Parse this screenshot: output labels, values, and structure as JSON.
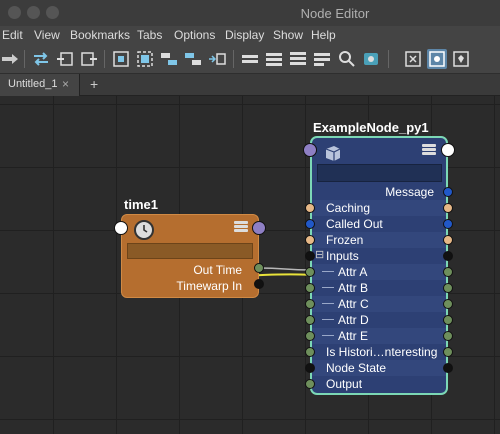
{
  "window": {
    "title": "Node Editor"
  },
  "menubar": [
    "Edit",
    "View",
    "Bookmarks",
    "Tabs",
    "Options",
    "Display",
    "Show",
    "Help"
  ],
  "toolbar": {
    "icons": [
      "graph-input-output-icon",
      "swap-connections-icon",
      "add-input-icon",
      "add-output-icon",
      "frame-all-icon",
      "frame-selected-icon",
      "graph-upstream-icon",
      "graph-downstream-icon",
      "layout-icon",
      "simple-mode-icon",
      "connected-mode-icon",
      "full-mode-icon",
      "custom-mode-icon",
      "search-icon",
      "snapshot-icon",
      "grid-toggle-icon",
      "grid-snap-icon",
      "pin-icon"
    ]
  },
  "tabs": [
    {
      "label": "Untitled_1",
      "close": "×"
    }
  ],
  "tab_add": "+",
  "time_node": {
    "name": "time1",
    "attributes": [
      "Out Time",
      "Timewarp In"
    ]
  },
  "example_node": {
    "name": "ExampleNode_py1",
    "attributes": [
      {
        "label": "Message",
        "align": "right",
        "alt": false,
        "in": null,
        "out": "#2158c8"
      },
      {
        "label": "Caching",
        "align": "left",
        "alt": true,
        "in": "#e6b887",
        "out": "#e6b887"
      },
      {
        "label": "Called Out",
        "align": "left",
        "alt": false,
        "in": "#2158c8",
        "out": "#2158c8"
      },
      {
        "label": "Frozen",
        "align": "left",
        "alt": true,
        "in": "#e6b887",
        "out": "#e6b887"
      },
      {
        "label": "Inputs",
        "align": "left",
        "alt": false,
        "in": "#111111",
        "out": "#111111",
        "group": true
      },
      {
        "label": "Attr A",
        "align": "child",
        "alt": true,
        "in": "#6e8f5c",
        "out": "#6e8f5c"
      },
      {
        "label": "Attr B",
        "align": "child",
        "alt": false,
        "in": "#6e8f5c",
        "out": "#6e8f5c"
      },
      {
        "label": "Attr C",
        "align": "child",
        "alt": true,
        "in": "#6e8f5c",
        "out": "#6e8f5c"
      },
      {
        "label": "Attr D",
        "align": "child",
        "alt": false,
        "in": "#6e8f5c",
        "out": "#6e8f5c"
      },
      {
        "label": "Attr E",
        "align": "child",
        "alt": true,
        "in": "#6e8f5c",
        "out": "#6e8f5c"
      },
      {
        "label": "Is Histori…nteresting",
        "align": "left",
        "alt": false,
        "in": "#6e8f5c",
        "out": "#6e8f5c"
      },
      {
        "label": "Node State",
        "align": "left",
        "alt": true,
        "in": "#111111",
        "out": "#111111"
      },
      {
        "label": "Output",
        "align": "left",
        "alt": false,
        "in": "#6e8f5c",
        "out": null
      }
    ]
  },
  "colors": {
    "time_node_fill": "#b56e2f",
    "example_node_fill": "#2d4074",
    "example_node_border": "#7cd8b6",
    "annotation_stroke": "#e9e33a",
    "port_white": "#ffffff",
    "port_purple": "#8e7fc4"
  }
}
